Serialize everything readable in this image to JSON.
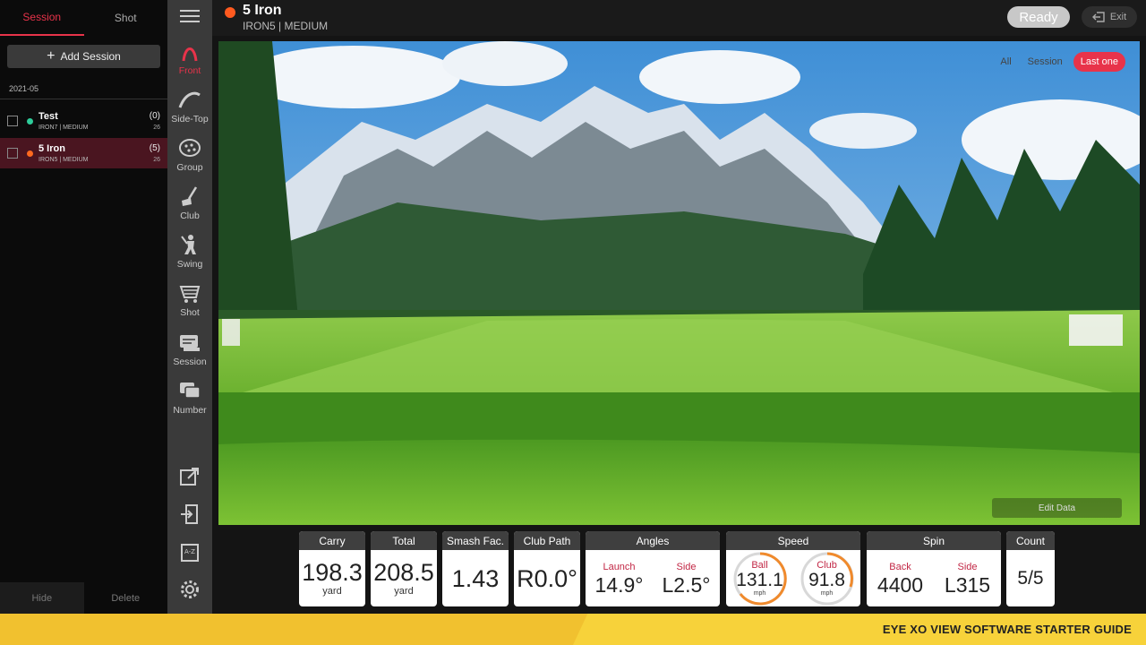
{
  "left_panel": {
    "tabs": [
      "Session",
      "Shot"
    ],
    "add_session_label": "Add Session",
    "date_group": "2021-05",
    "sessions": [
      {
        "name": "Test",
        "sub": "IRON7 | MEDIUM",
        "count": "(0)",
        "num": "26",
        "dot_color": "#2ecc9a"
      },
      {
        "name": "5 Iron",
        "sub": "IRON5 | MEDIUM",
        "count": "(5)",
        "num": "26",
        "dot_color": "#ff6a1f"
      }
    ],
    "hide_label": "Hide",
    "delete_label": "Delete"
  },
  "icon_bar": {
    "items": [
      {
        "label": "Front",
        "icon": "front-arc-icon"
      },
      {
        "label": "Side-Top",
        "icon": "side-top-arc-icon"
      },
      {
        "label": "Group",
        "icon": "group-scatter-icon"
      },
      {
        "label": "Club",
        "icon": "club-icon"
      },
      {
        "label": "Swing",
        "icon": "swing-icon"
      },
      {
        "label": "Shot",
        "icon": "shot-icon"
      },
      {
        "label": "Session",
        "icon": "session-icon"
      },
      {
        "label": "Number",
        "icon": "number-icon"
      }
    ]
  },
  "topbar": {
    "title": "5 Iron",
    "subtitle": "IRON5 | MEDIUM",
    "ready_label": "Ready",
    "exit_label": "Exit"
  },
  "scene": {
    "filters": [
      "All",
      "Session",
      "Last one"
    ],
    "active_filter": "Last one",
    "edit_data_label": "Edit Data"
  },
  "stats": {
    "carry": {
      "label": "Carry",
      "value": "198.3",
      "unit": "yard"
    },
    "total": {
      "label": "Total",
      "value": "208.5",
      "unit": "yard"
    },
    "smash": {
      "label": "Smash Fac.",
      "value": "1.43"
    },
    "club_path": {
      "label": "Club Path",
      "value": "R0.0°"
    },
    "angles": {
      "label": "Angles",
      "launch_label": "Launch",
      "launch_value": "14.9°",
      "side_label": "Side",
      "side_value": "L2.5°"
    },
    "speed": {
      "label": "Speed",
      "ball_label": "Ball",
      "ball_value": "131.1",
      "ball_unit": "mph",
      "club_label": "Club",
      "club_value": "91.8",
      "club_unit": "mph"
    },
    "spin": {
      "label": "Spin",
      "back_label": "Back",
      "back_value": "4400",
      "side_label": "Side",
      "side_value": "L315"
    },
    "count": {
      "label": "Count",
      "value": "5/5"
    }
  },
  "footer": {
    "text": "EYE XO VIEW SOFTWARE STARTER GUIDE"
  },
  "colors": {
    "accent": "#e8334a",
    "footer": "#f1c12f"
  }
}
